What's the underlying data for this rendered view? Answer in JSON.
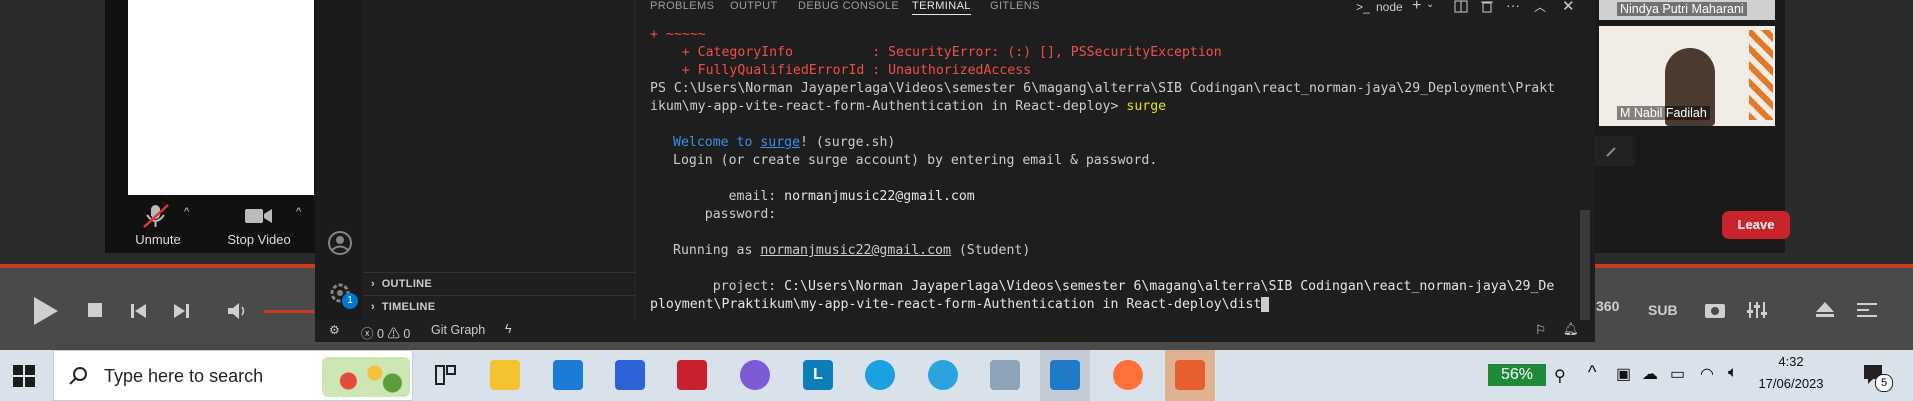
{
  "zoom": {
    "unmute_label": "Unmute",
    "stop_video_label": "Stop Video",
    "leave_label": "Leave",
    "participants": [
      {
        "name": "Nindya Putri Maharani"
      },
      {
        "name": "M Nabil Fadilah"
      }
    ]
  },
  "vscode": {
    "panel_tabs": [
      "PROBLEMS",
      "OUTPUT",
      "DEBUG CONSOLE",
      "TERMINAL",
      "GITLENS"
    ],
    "active_tab": "TERMINAL",
    "terminal_name": "node",
    "sidebar_sections": [
      "OUTLINE",
      "TIMELINE"
    ],
    "accounts_badge": "1",
    "status": {
      "errors": "0",
      "warnings": "0",
      "git_graph": "Git Graph"
    },
    "terminal": {
      "line0": "+ ~~~~~",
      "line1": "    + CategoryInfo          : SecurityError: (:) [], PSSecurityException",
      "line2": "    + FullyQualifiedErrorId : UnauthorizedAccess",
      "prompt_path_1": "PS C:\\Users\\Norman Jayaperlaga\\Videos\\semester 6\\magang\\alterra\\SIB Codingan\\react_norman-jaya\\29_Deployment\\Prakt",
      "prompt_path_2": "ikum\\my-app-vite-react-form-Authentication in React-deploy> ",
      "command": "surge",
      "welcome_a": "Welcome to ",
      "welcome_link": "surge",
      "welcome_b": "! (surge.sh)",
      "login_line": "Login (or create surge account) by entering email & password.",
      "email_label": "       email: ",
      "email_value": "normanjmusic22@gmail.com",
      "password_label": "    password:",
      "running_a": "Running as ",
      "running_email": "normanjmusic22@gmail.com",
      "running_b": " (Student)",
      "project_label": "     project: ",
      "project_value_1": "C:\\Users\\Norman Jayaperlaga\\Videos\\semester 6\\magang\\alterra\\SIB Codingan\\react_norman-jaya\\29_De",
      "project_value_2": "ployment\\Praktikum\\my-app-vite-react-form-Authentication in React-deploy\\dist"
    }
  },
  "player": {
    "btn_360": "360",
    "btn_sub": "SUB"
  },
  "taskbar": {
    "search_placeholder": "Type here to search",
    "battery_percent": "56%",
    "time": "4:32",
    "date": "17/06/2023",
    "notification_count": "5"
  }
}
